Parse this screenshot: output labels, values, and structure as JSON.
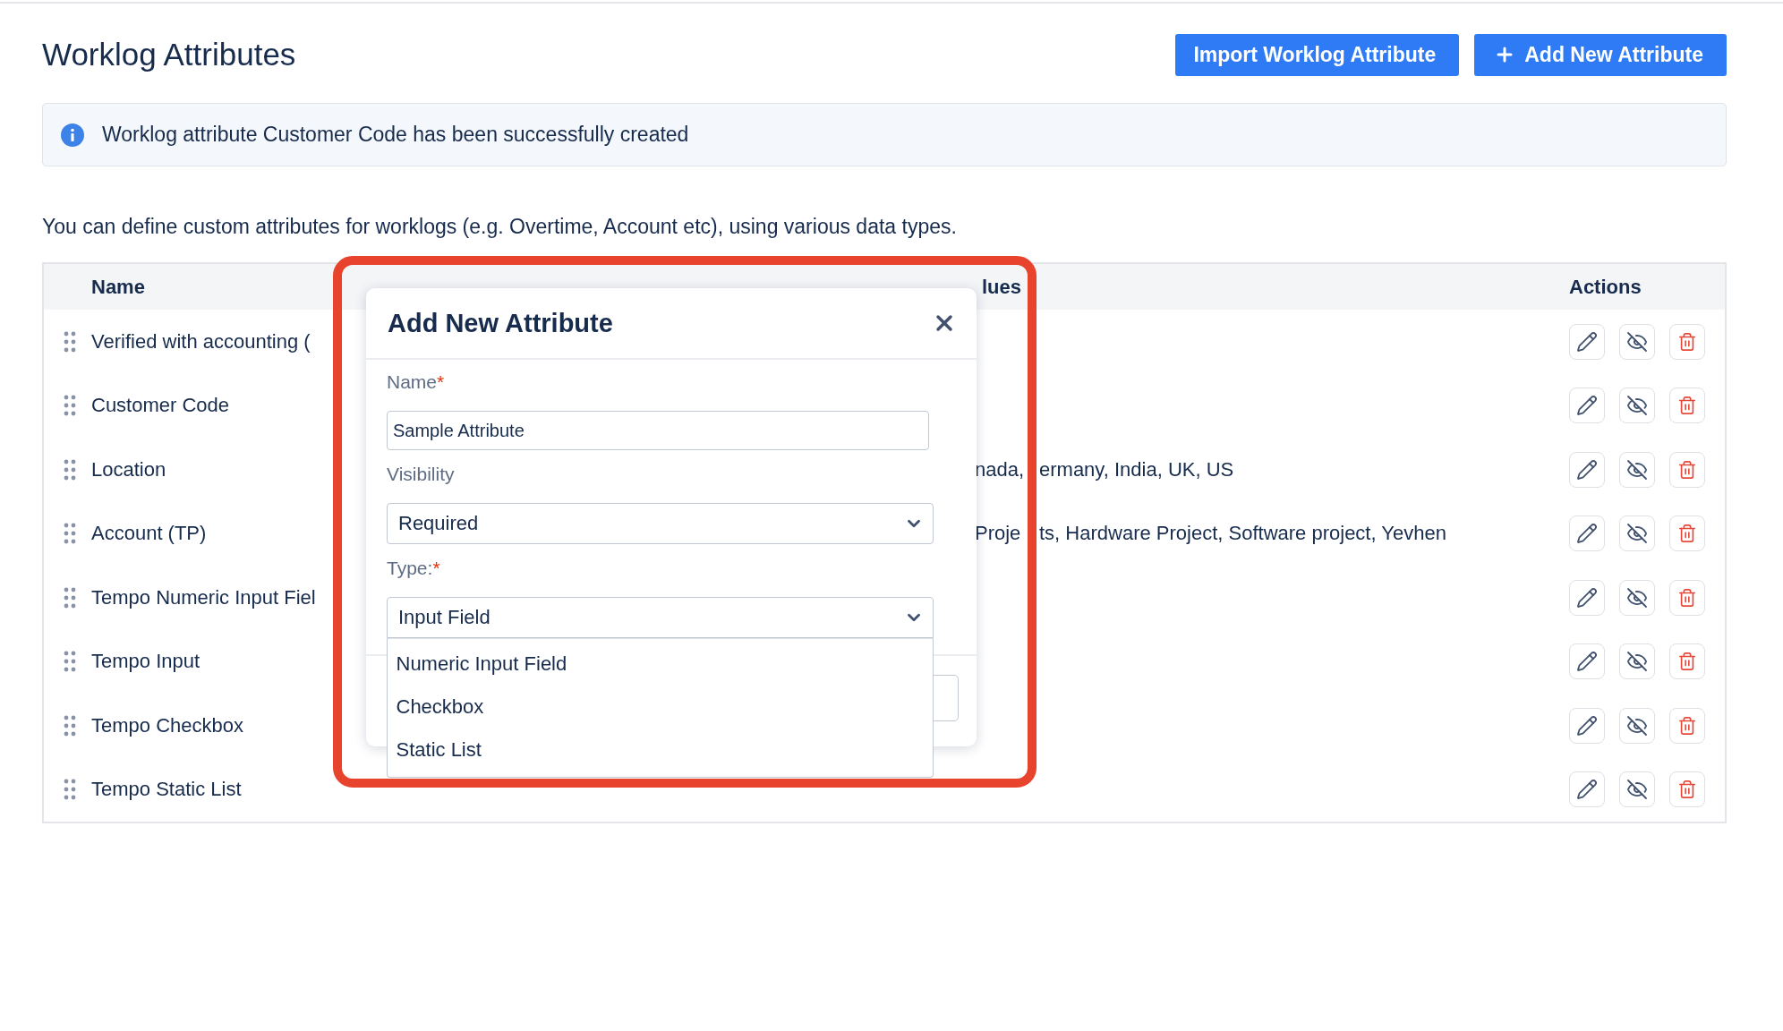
{
  "page": {
    "title": "Worklog Attributes"
  },
  "buttons": [
    {
      "label": "Import Worklog Attribute",
      "kind": "plain"
    },
    {
      "label": "Add New Attribute",
      "kind": "add"
    }
  ],
  "banner": {
    "message": "Worklog attribute Customer Code has been successfully created"
  },
  "description": "You can define custom attributes for worklogs (e.g. Overtime, Account etc), using various data types.",
  "table": {
    "headings": {
      "name": "Name",
      "values": "lues",
      "actions": "Actions"
    },
    "rows": [
      {
        "name": "Verified with accounting ("
      },
      {
        "name": "Customer Code"
      },
      {
        "name": "Location",
        "values": [
          "nada,",
          "ermany, India, UK, US"
        ]
      },
      {
        "name": "Account (TP)",
        "values": [
          "Proje",
          "ts, Hardware Project, Software project, Yevhen"
        ]
      },
      {
        "name": "Tempo Numeric Input Fiel"
      },
      {
        "name": "Tempo Input"
      },
      {
        "name": "Tempo Checkbox"
      },
      {
        "name": "Tempo Static List"
      }
    ]
  },
  "dialog": {
    "title": "Add New Attribute",
    "fields": [
      {
        "label": "Name",
        "required_mark": "*",
        "kind": "text",
        "value": "Sample Attribute"
      },
      {
        "label": "Visibility",
        "kind": "select",
        "value": "Required",
        "expanded": false
      },
      {
        "label": "Type:",
        "required_mark": "*",
        "kind": "select",
        "value": "Input Field",
        "expanded": true,
        "options": [
          {
            "label": "Numeric Input Field",
            "selected": false
          },
          {
            "label": "Checkbox",
            "selected": false
          },
          {
            "label": "Static List",
            "selected": false
          }
        ]
      }
    ]
  }
}
